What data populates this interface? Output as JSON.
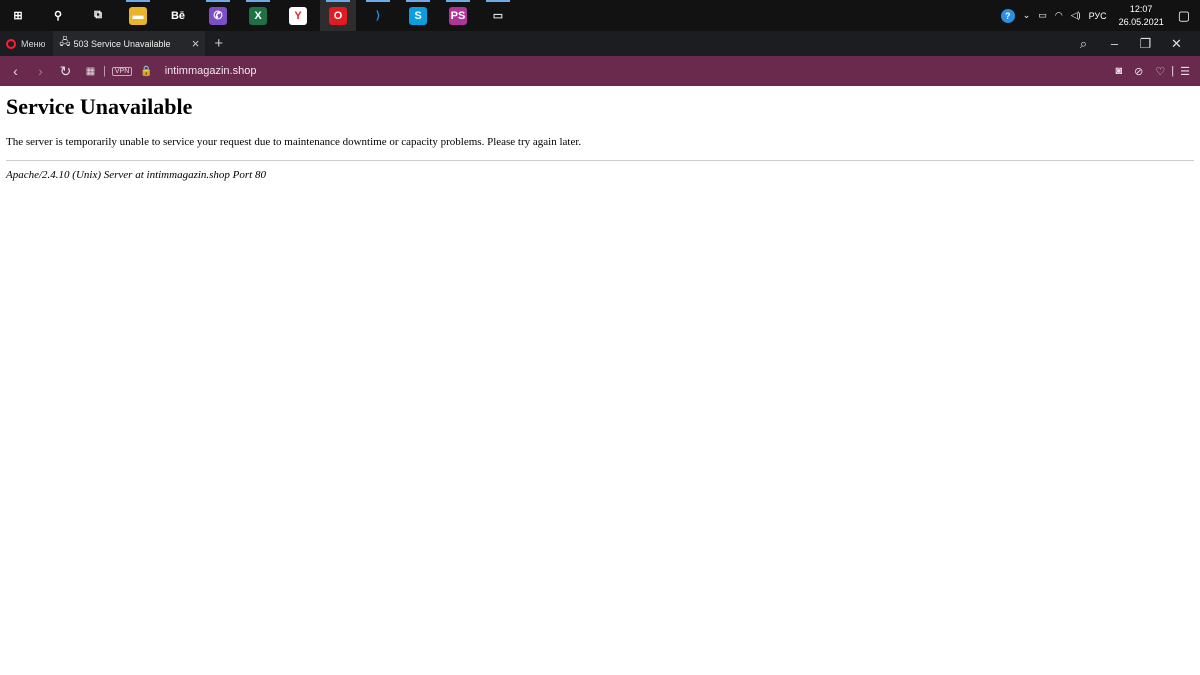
{
  "taskbar": {
    "apps": [
      {
        "icon": "windows-start-icon",
        "glyph": "⊞",
        "bg": "transparent",
        "color": "#ffffff",
        "active": false,
        "running": false
      },
      {
        "icon": "search-icon",
        "glyph": "⚲",
        "bg": "transparent",
        "color": "#ffffff",
        "active": false,
        "running": false
      },
      {
        "icon": "task-view-icon",
        "glyph": "⧉",
        "bg": "transparent",
        "color": "#ffffff",
        "active": false,
        "running": false
      },
      {
        "icon": "file-explorer-icon",
        "glyph": "▬",
        "bg": "#e8b42a",
        "color": "#ffffff",
        "active": false,
        "running": true
      },
      {
        "icon": "behance-icon",
        "glyph": "Bē",
        "bg": "transparent",
        "color": "#ffffff",
        "active": false,
        "running": false
      },
      {
        "icon": "viber-icon",
        "glyph": "✆",
        "bg": "#7d4fc7",
        "color": "#ffffff",
        "active": false,
        "running": true
      },
      {
        "icon": "excel-icon",
        "glyph": "X",
        "bg": "#1f7145",
        "color": "#ffffff",
        "active": false,
        "running": true
      },
      {
        "icon": "yandex-browser-icon",
        "glyph": "Y",
        "bg": "#ffffff",
        "color": "#e0262a",
        "active": false,
        "running": false
      },
      {
        "icon": "opera-icon",
        "glyph": "O",
        "bg": "#e01b24",
        "color": "#ffffff",
        "active": true,
        "running": true
      },
      {
        "icon": "vscode-icon",
        "glyph": "⟩",
        "bg": "transparent",
        "color": "#2b8ce0",
        "active": false,
        "running": true
      },
      {
        "icon": "skype-icon",
        "glyph": "S",
        "bg": "#0a9ee0",
        "color": "#ffffff",
        "active": false,
        "running": true
      },
      {
        "icon": "phpstorm-icon",
        "glyph": "PS",
        "bg": "#b0359b",
        "color": "#ffffff",
        "active": false,
        "running": true
      },
      {
        "icon": "terminal-icon",
        "glyph": "▭",
        "bg": "transparent",
        "color": "#dddddd",
        "active": false,
        "running": true
      }
    ],
    "language": "РУС",
    "time": "12:07",
    "date": "26.05.2021"
  },
  "browser": {
    "menu_label": "Меню",
    "tab_title": "503 Service Unavailable",
    "url": "intimmagazin.shop",
    "vpn_label": "VPN",
    "accent_color": "#6a2a4e"
  },
  "page": {
    "heading": "Service Unavailable",
    "message": "The server is temporarily unable to service your request due to maintenance downtime or capacity problems. Please try again later.",
    "signature": "Apache/2.4.10 (Unix) Server at intimmagazin.shop Port 80"
  }
}
